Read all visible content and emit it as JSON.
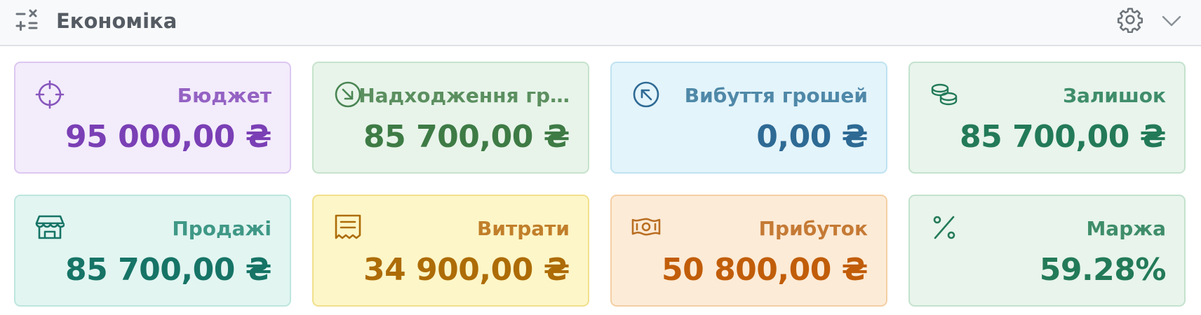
{
  "header": {
    "title": "Економіка",
    "icons": {
      "menu": "calculator-ops-icon",
      "settings": "gear-icon",
      "collapse": "chevron-down-icon"
    }
  },
  "cards": [
    {
      "label": "Бюджет",
      "value": "95 000,00 ₴",
      "icon": "target-icon",
      "bg": "#f3ecfb",
      "border": "#dcc7f1",
      "labelColor": "#9462c3",
      "valueColor": "#7a3fb5",
      "iconColor": "#8856bd"
    },
    {
      "label": "Надходження гр…",
      "value": "85 700,00 ₴",
      "icon": "arrow-down-right-circle-icon",
      "bg": "#e8f4ea",
      "border": "#c6e3cc",
      "labelColor": "#5b8f5f",
      "valueColor": "#3e7b45",
      "iconColor": "#4a8552"
    },
    {
      "label": "Вибуття грошей",
      "value": "0,00 ₴",
      "icon": "arrow-up-left-circle-icon",
      "bg": "#e3f4fb",
      "border": "#bfe3f1",
      "labelColor": "#4f88a8",
      "valueColor": "#2e6a94",
      "iconColor": "#2e6a94"
    },
    {
      "label": "Залишок",
      "value": "85 700,00 ₴",
      "icon": "coins-icon",
      "bg": "#e8f4ec",
      "border": "#c4e2ce",
      "labelColor": "#3f8d6a",
      "valueColor": "#237a58",
      "iconColor": "#237a58"
    },
    {
      "label": "Продажі",
      "value": "85 700,00 ₴",
      "icon": "shop-icon",
      "bg": "#e2f5f1",
      "border": "#bde6de",
      "labelColor": "#3f9886",
      "valueColor": "#167466",
      "iconColor": "#167466"
    },
    {
      "label": "Витрати",
      "value": "34 900,00 ₴",
      "icon": "receipt-icon",
      "bg": "#fdf6c8",
      "border": "#f1e08d",
      "labelColor": "#c17f2a",
      "valueColor": "#ad6c06",
      "iconColor": "#ad6c06"
    },
    {
      "label": "Прибуток",
      "value": "50 800,00 ₴",
      "icon": "cash-icon",
      "bg": "#fcebd7",
      "border": "#f4cfa4",
      "labelColor": "#c57a35",
      "valueColor": "#c15d09",
      "iconColor": "#b96e22"
    },
    {
      "label": "Маржа",
      "value": "59.28%",
      "icon": "percent-icon",
      "bg": "#e8f4ec",
      "border": "#c4e2ce",
      "labelColor": "#3f8d6a",
      "valueColor": "#237a58",
      "iconColor": "#237a58"
    }
  ]
}
